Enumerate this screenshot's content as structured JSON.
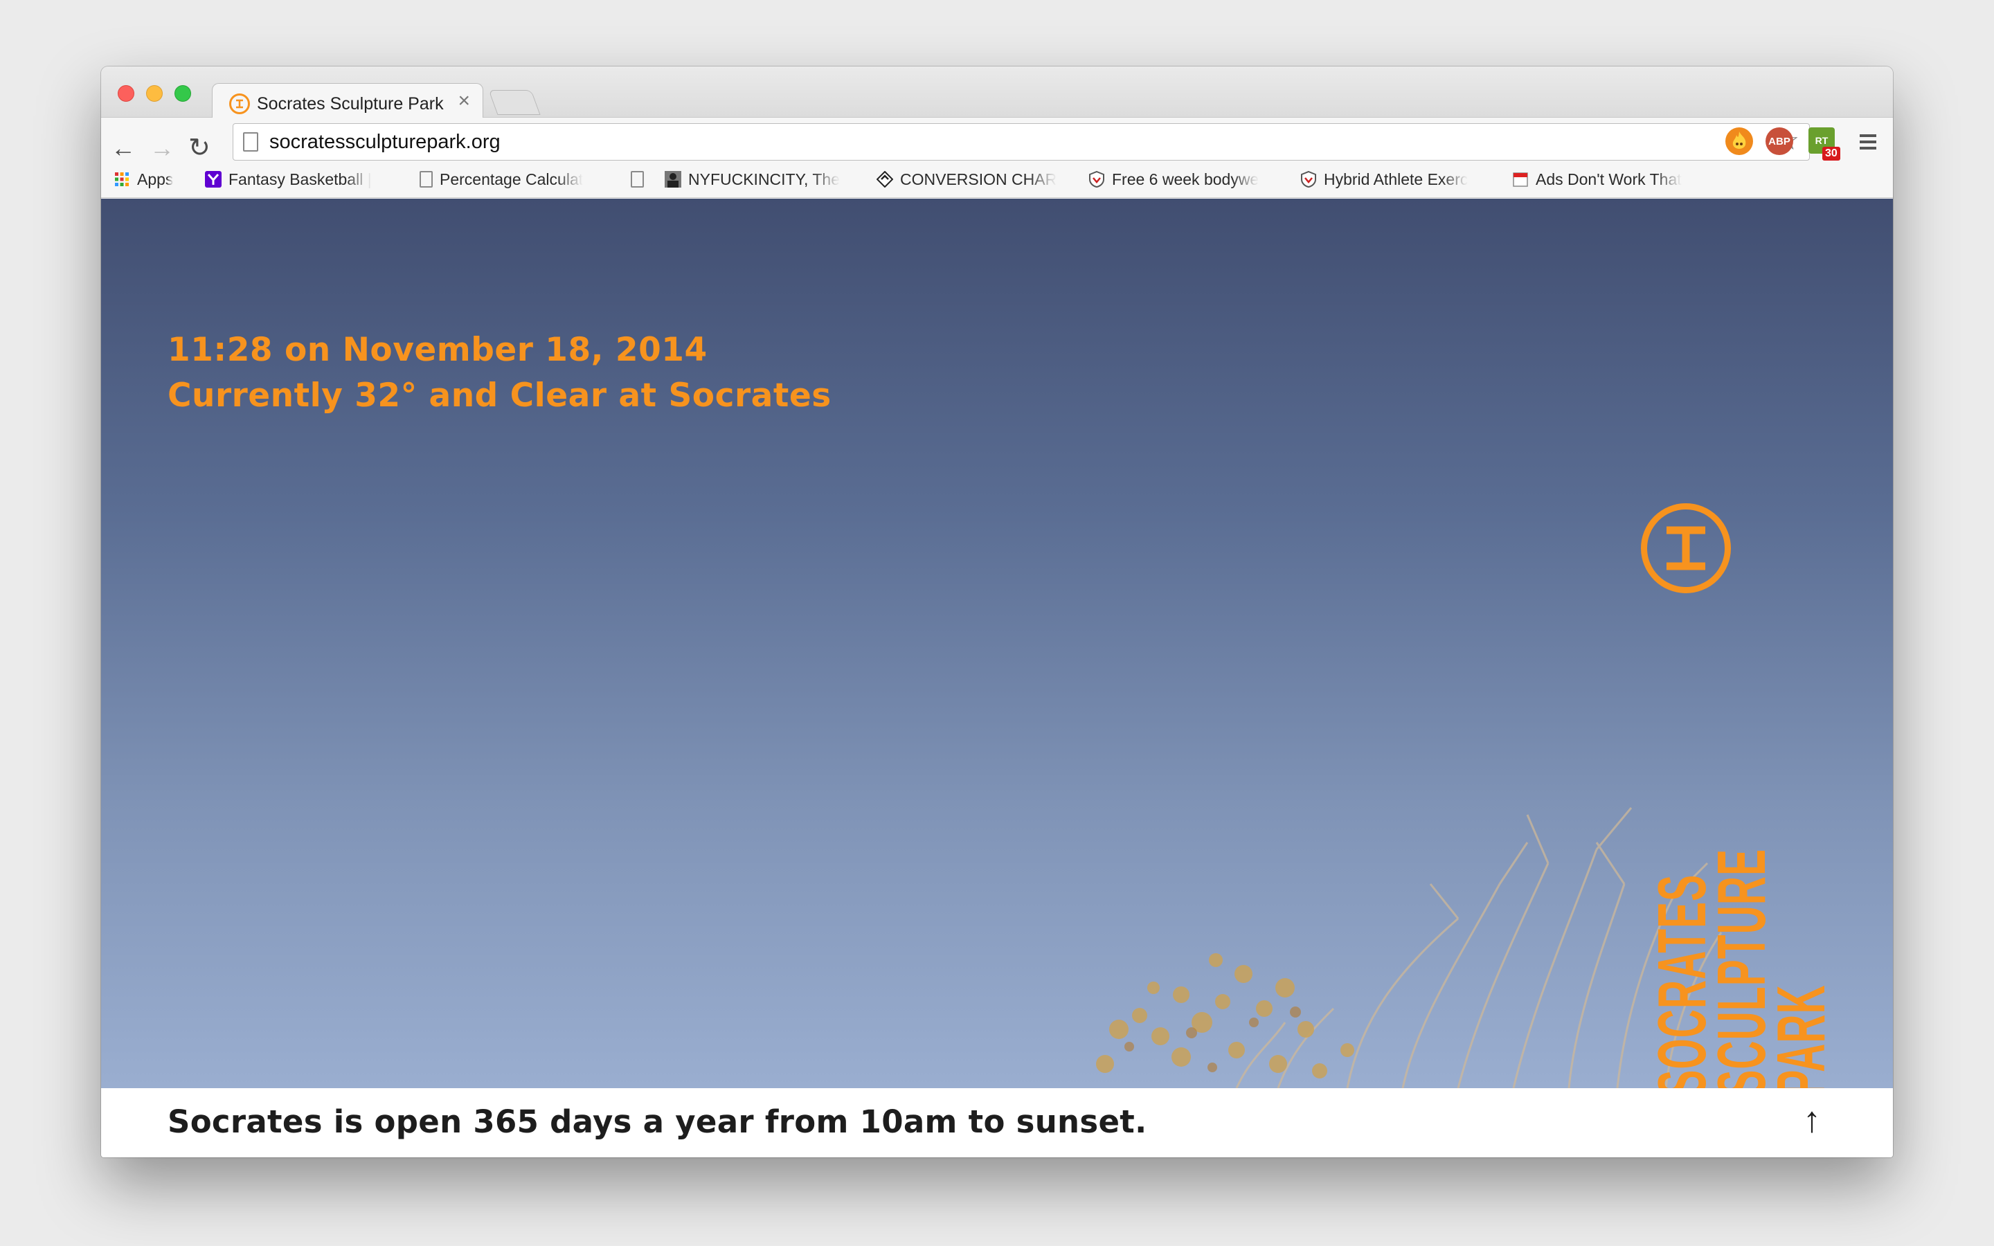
{
  "browser": {
    "tab_title": "Socrates Sculpture Park",
    "tab_close": "×",
    "url": "socratessculpturepark.org",
    "extensions": [
      "fire-extension-icon",
      "adblock-plus-icon",
      "rt-extension-icon"
    ],
    "extension_badge": "30",
    "abp_label": "ABP",
    "rt_label": "RT"
  },
  "bookmarks": [
    {
      "label": "Apps",
      "icon": "apps-grid-icon"
    },
    {
      "label": "Fantasy Basketball |",
      "icon": "yahoo-icon"
    },
    {
      "label": "Percentage Calculat",
      "icon": "page-icon"
    },
    {
      "label": "",
      "icon": "page-icon"
    },
    {
      "label": "NYFUCKINCITY, The",
      "icon": "person-thumbnail-icon"
    },
    {
      "label": "CONVERSION CHAR",
      "icon": "conversion-icon"
    },
    {
      "label": "Free 6 week bodywe",
      "icon": "shield-icon"
    },
    {
      "label": "Hybrid Athlete Exerc",
      "icon": "shield-icon"
    },
    {
      "label": "Ads Don't Work That",
      "icon": "calendar-icon"
    }
  ],
  "page": {
    "datetime_line": "11:28 on November 18, 2014",
    "weather_line": "Currently 32° and Clear at Socrates",
    "wordmark": [
      "SOCRATES",
      "SCULPTURE",
      "PARK"
    ],
    "footer_text": "Socrates is open 365 days a year from 10am to sunset.",
    "back_to_top": "↑"
  },
  "colors": {
    "accent": "#f7931e",
    "footer_text": "#1d1d1d"
  }
}
